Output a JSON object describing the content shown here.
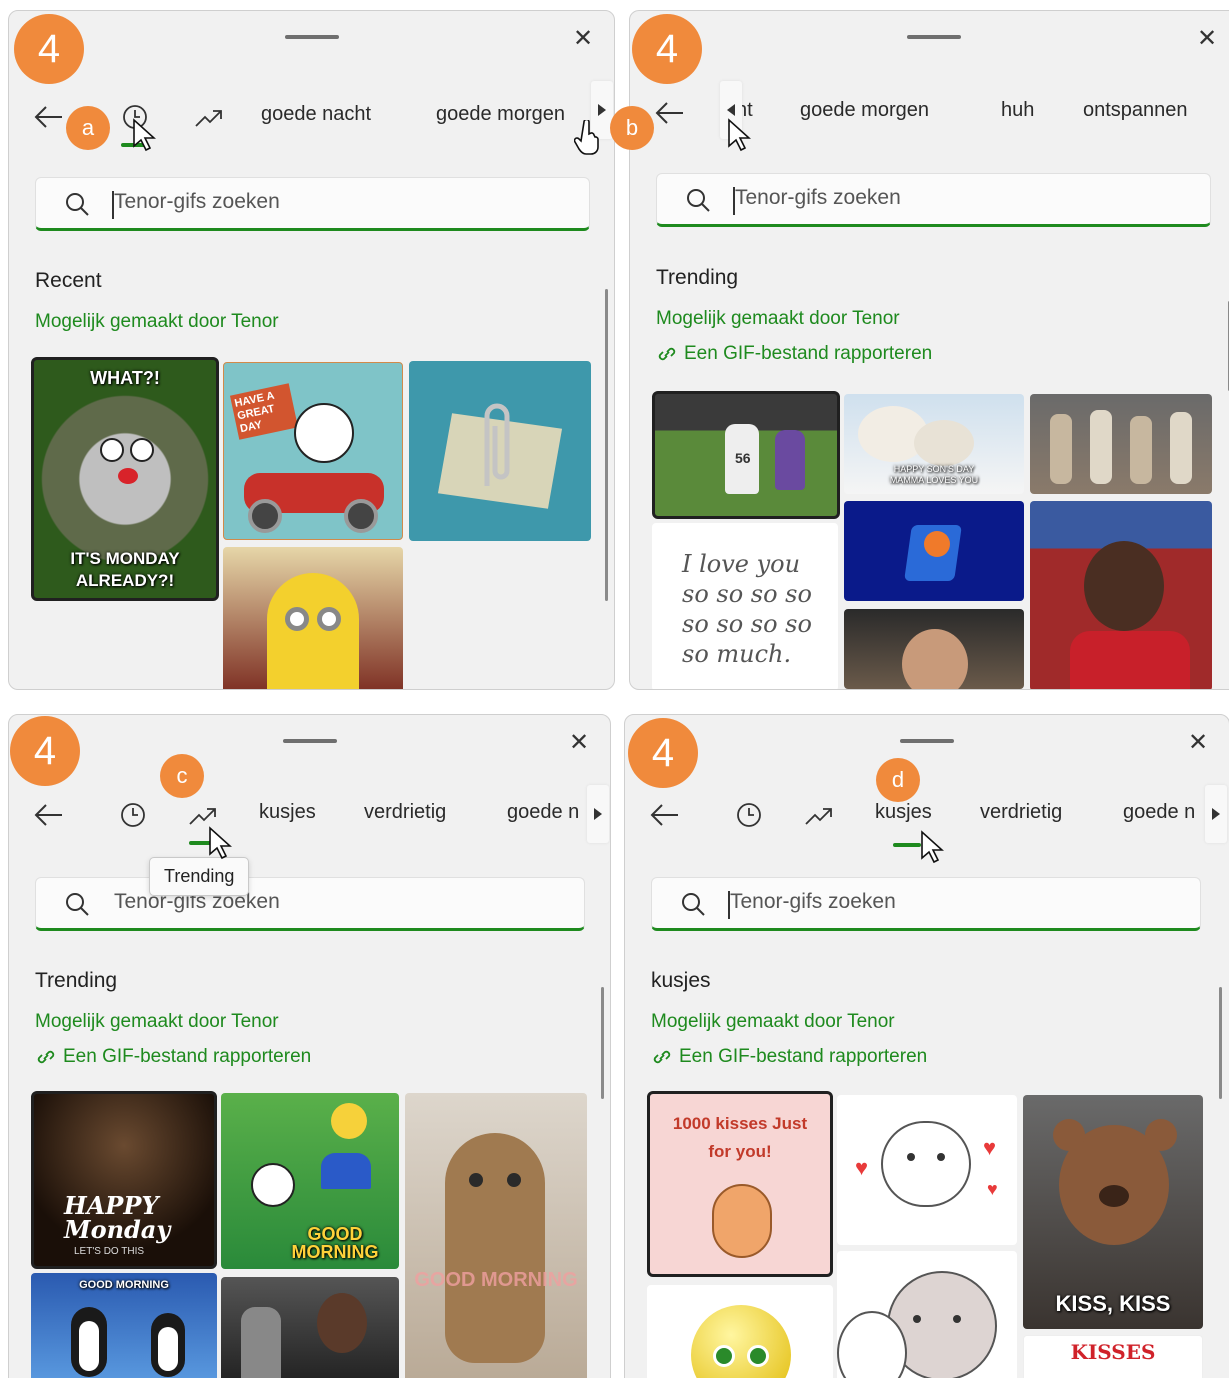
{
  "step_number": "4",
  "search": {
    "placeholder": "Tenor-gifs zoeken"
  },
  "attribution": "Mogelijk gemaakt door Tenor",
  "report": "Een GIF-bestand rapporteren",
  "markers": {
    "a": "a",
    "b": "b",
    "c": "c",
    "d": "d"
  },
  "panel1": {
    "tabs": [
      "goede nacht",
      "goede morgen"
    ],
    "section": "Recent",
    "gifs": [
      {
        "top": "WHAT?!",
        "bottom": "IT'S MONDAY ALREADY?!"
      },
      {
        "top": "HAVE A GREAT DAY"
      }
    ]
  },
  "panel2": {
    "tabs": [
      "nt",
      "goede morgen",
      "huh",
      "ontspannen"
    ],
    "section": "Trending",
    "gifs": [
      {
        "text": "56"
      },
      {
        "text": "HAPPY SON'S DAY MAMMA LOVES YOU"
      },
      {
        "text": "I love you so so so so so so so so so much."
      }
    ]
  },
  "panel3": {
    "tabs": [
      "kusjes",
      "verdrietig",
      "goede n"
    ],
    "tooltip": "Trending",
    "section": "Trending",
    "gifs": [
      {
        "text": "HAPPY Monday",
        "sub": "LET'S DO THIS"
      },
      {
        "text": "GOOD MORNING"
      },
      {
        "text": "GOOD MORNING"
      },
      {
        "text": "GOOD MORNING"
      }
    ]
  },
  "panel4": {
    "tabs": [
      "kusjes",
      "verdrietig",
      "goede n"
    ],
    "section": "kusjes",
    "gifs": [
      {
        "text": "1000 kisses Just for you!"
      },
      {
        "text": "KISS, KISS"
      },
      {
        "text": "KISSES"
      }
    ]
  },
  "colors": {
    "accent": "#1e8a1e",
    "badge": "#f08a3c",
    "panel": "#f1f1f1"
  }
}
